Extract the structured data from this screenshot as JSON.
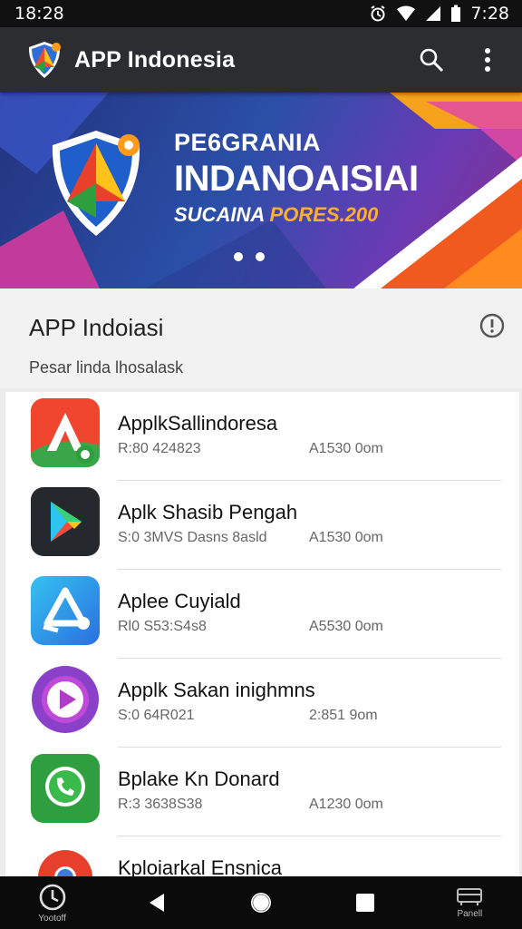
{
  "status_bar": {
    "time_left": "18:28",
    "time_right": "7:28"
  },
  "app_bar": {
    "title": "APP Indonesia",
    "search_icon": "search-icon",
    "menu_icon": "more-vert-icon"
  },
  "banner": {
    "line1": "PE6GRANIA",
    "line2": "INDANOAISIAI",
    "line3_a": "SUCAINA",
    "line3_b": "PORES.200",
    "pages": 2
  },
  "section": {
    "title": "APP Indoiasi",
    "subtitle": "Pesar linda lhosalask",
    "info_icon": "info-icon"
  },
  "apps": [
    {
      "name": "ApplkSallindoresa",
      "meta": "R:80 424823",
      "size": "A1530 0om",
      "icon": "orange-a-icon",
      "bg": "#f0452f"
    },
    {
      "name": "Aplk Shasib Pengah",
      "meta": "S:0 3MVS Dasns 8asld",
      "size": "A1530 0om",
      "icon": "play-store-icon",
      "bg": "#25282d"
    },
    {
      "name": "Aplee Cuyiald",
      "meta": "Rl0 S53:S4s8",
      "size": "A5530 0om",
      "icon": "share-triangle-icon",
      "bg": "#2fa8e8"
    },
    {
      "name": "Applk Sakan inighmns",
      "meta": "S:0 64R021",
      "size": "2:851 9om",
      "icon": "media-play-icon",
      "bg": "#8a40c9"
    },
    {
      "name": "Bplake Kn Donard",
      "meta": "R:3 3638S38",
      "size": "A1230 0om",
      "icon": "phone-app-icon",
      "bg": "#2f9e3e"
    },
    {
      "name": "Kploiarkal Ensnica",
      "meta": "",
      "size": "",
      "icon": "chrome-icon",
      "bg": "#ffffff"
    }
  ],
  "nav": {
    "left_label": "Yootoff",
    "right_label": "Panell"
  },
  "colors": {
    "app_bar": "#2b2d31",
    "banner_accent": "#ffb02a",
    "nav": "#0b0b0b"
  }
}
